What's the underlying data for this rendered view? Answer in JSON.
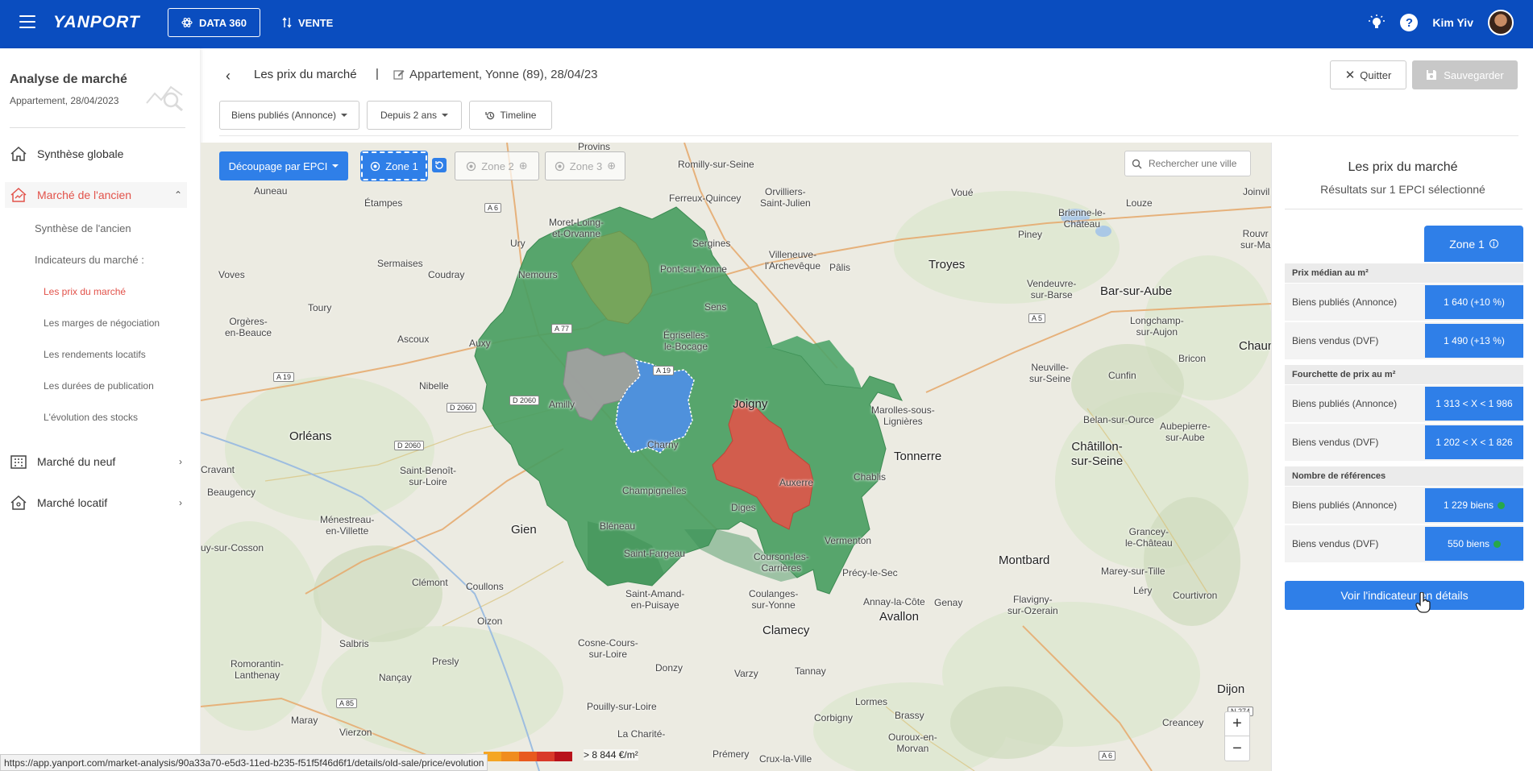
{
  "topbar": {
    "logo": "YANPORT",
    "data360_label": "DATA 360",
    "vente_label": "VENTE",
    "user_name": "Kim Yiv"
  },
  "sidebar": {
    "title": "Analyse de marché",
    "subtitle": "Appartement, 28/04/2023",
    "items": [
      {
        "label": "Synthèse globale"
      },
      {
        "label": "Marché de l'ancien"
      },
      {
        "label": "Marché du neuf"
      },
      {
        "label": "Marché locatif"
      }
    ],
    "sub_items": [
      {
        "label": "Synthèse de l'ancien"
      },
      {
        "label": "Indicateurs du marché :"
      }
    ],
    "indicators": [
      {
        "label": "Les prix du marché"
      },
      {
        "label": "Les marges de négociation"
      },
      {
        "label": "Les rendements locatifs"
      },
      {
        "label": "Les durées de publication"
      },
      {
        "label": "L'évolution des stocks"
      }
    ]
  },
  "header": {
    "title": "Les prix du marché",
    "separator": "|",
    "subtitle": "Appartement, Yonne (89), 28/04/23",
    "quit_label": "Quitter",
    "save_label": "Sauvegarder"
  },
  "filters": {
    "source": "Biens publiés (Annonce)",
    "period": "Depuis 2 ans",
    "timeline": "Timeline"
  },
  "map": {
    "decoupage_label": "Découpage par EPCI",
    "zones": [
      "Zone 1",
      "Zone 2",
      "Zone 3"
    ],
    "search_placeholder": "Rechercher une ville",
    "zoom_in": "+",
    "zoom_out": "−",
    "legend_text": "> 8 844 €/m²",
    "legend_colors": [
      "#f5a623",
      "#f08c1e",
      "#e85a1f",
      "#d93a2a",
      "#b8121b"
    ],
    "region_colors": {
      "green": "#4a9e62",
      "light_green": "#7aa55a",
      "grey": "#a0a0a0",
      "blue": "#4f8fe3",
      "red": "#d9594c"
    },
    "places": [
      {
        "name": "Provins"
      },
      {
        "name": "Romilly-sur-Seine"
      },
      {
        "name": "Auneau"
      },
      {
        "name": "Étampes"
      },
      {
        "name": "Moret-Loing-\net-Orvanne"
      },
      {
        "name": "Ferreux-Quincey"
      },
      {
        "name": "Orvilliers-\nSaint-Julien"
      },
      {
        "name": "Voué"
      },
      {
        "name": "Piney"
      },
      {
        "name": "Brienne-le-\nChâteau"
      },
      {
        "name": "Louze"
      },
      {
        "name": "Joinvil"
      },
      {
        "name": "Sergines"
      },
      {
        "name": "Pont-sur-Yonne"
      },
      {
        "name": "Villeneuve-\nl'Archevêque"
      },
      {
        "name": "Pâlis"
      },
      {
        "name": "Troyes"
      },
      {
        "name": "Ury"
      },
      {
        "name": "Sermaises"
      },
      {
        "name": "Coudray"
      },
      {
        "name": "Nemours"
      },
      {
        "name": "Voves"
      },
      {
        "name": "Sens"
      },
      {
        "name": "Vendeuvre-\nsur-Barse"
      },
      {
        "name": "Bar-sur-Aube"
      },
      {
        "name": "Rouvr\nsur-Ma"
      },
      {
        "name": "Toury"
      },
      {
        "name": "Orgères-\nen-Beauce"
      },
      {
        "name": "Ascoux"
      },
      {
        "name": "Auxy"
      },
      {
        "name": "Égriselles-\nle-Bocage"
      },
      {
        "name": "Longchamp-\nsur-Aujon"
      },
      {
        "name": "Chaum"
      },
      {
        "name": "Neuville-\nsur-Seine"
      },
      {
        "name": "Cunfin"
      },
      {
        "name": "Bricon"
      },
      {
        "name": "Nibelle"
      },
      {
        "name": "Amilly"
      },
      {
        "name": "Joigny"
      },
      {
        "name": "Marolles-sous-\nLignières"
      },
      {
        "name": "Orléans"
      },
      {
        "name": "Charny"
      },
      {
        "name": "Belan-sur-Ource"
      },
      {
        "name": "Aubepierre-\nsur-Aube"
      },
      {
        "name": "Tonnerre"
      },
      {
        "name": "Châtillon-\nsur-Seine"
      },
      {
        "name": "Cravant"
      },
      {
        "name": "Saint-Benoît-\nsur-Loire"
      },
      {
        "name": "Auxerre"
      },
      {
        "name": "Chablis"
      },
      {
        "name": "Beaugency"
      },
      {
        "name": "Champignelles"
      },
      {
        "name": "Diges"
      },
      {
        "name": "Ménestreau-\nen-Villette"
      },
      {
        "name": "Bléneau"
      },
      {
        "name": "Gien"
      },
      {
        "name": "Vermenton"
      },
      {
        "name": "Grancey-\nle-Château"
      },
      {
        "name": "uy-sur-Cosson"
      },
      {
        "name": "Saint-Fargeau"
      },
      {
        "name": "Courson-les-\nCarrières"
      },
      {
        "name": "Montbard"
      },
      {
        "name": "Coullons"
      },
      {
        "name": "Précy-le-Sec"
      },
      {
        "name": "Marey-sur-Tille"
      },
      {
        "name": "Clémont"
      },
      {
        "name": "Saint-Amand-\nen-Puisaye"
      },
      {
        "name": "Coulanges-\nsur-Yonne"
      },
      {
        "name": "Annay-la-Côte"
      },
      {
        "name": "Genay"
      },
      {
        "name": "Léry"
      },
      {
        "name": "Courtivron"
      },
      {
        "name": "Avallon"
      },
      {
        "name": "Flavigny-\nsur-Ozerain"
      },
      {
        "name": "Oizon"
      },
      {
        "name": "Clamecy"
      },
      {
        "name": "Salbris"
      },
      {
        "name": "Presly"
      },
      {
        "name": "Cosne-Cours-\nsur-Loire"
      },
      {
        "name": "Romorantin-\nLanthenay"
      },
      {
        "name": "Nançay"
      },
      {
        "name": "Donzy"
      },
      {
        "name": "Varzy"
      },
      {
        "name": "Tannay"
      },
      {
        "name": "Maray"
      },
      {
        "name": "Pouilly-sur-Loire"
      },
      {
        "name": "Lormes"
      },
      {
        "name": "Dijon"
      },
      {
        "name": "Vierzon"
      },
      {
        "name": "Corbigny"
      },
      {
        "name": "Brassy"
      },
      {
        "name": "Creancey"
      },
      {
        "name": "La Charité-"
      },
      {
        "name": "Prémery"
      },
      {
        "name": "Crux-la-Ville"
      },
      {
        "name": "Ouroux-en-\nMorvan"
      }
    ],
    "roads": [
      "A 6",
      "A 77",
      "A 19",
      "A 19",
      "D 2060",
      "D 2060",
      "D 2060",
      "A 5",
      "A 85",
      "A 6",
      "N 274"
    ]
  },
  "panel": {
    "title": "Les prix du marché",
    "subtitle": "Résultats sur 1 EPCI sélectionné",
    "zone_tab": "Zone 1",
    "sections": [
      {
        "heading": "Prix médian au m²",
        "rows": [
          {
            "label": "Biens publiés (Annonce)",
            "value": "1 640 (+10 %)"
          },
          {
            "label": "Biens vendus (DVF)",
            "value": "1 490 (+13 %)"
          }
        ]
      },
      {
        "heading": "Fourchette de prix au m²",
        "rows": [
          {
            "label": "Biens publiés (Annonce)",
            "value": "1 313 < X < 1 986"
          },
          {
            "label": "Biens vendus (DVF)",
            "value": "1 202 < X < 1 826"
          }
        ]
      },
      {
        "heading": "Nombre de références",
        "rows": [
          {
            "label": "Biens publiés (Annonce)",
            "value": "1 229 biens"
          },
          {
            "label": "Biens vendus (DVF)",
            "value": "550 biens"
          }
        ]
      }
    ],
    "details_button": "Voir l'indicateur en détails"
  },
  "status_url": "https://app.yanport.com/market-analysis/90a33a70-e5d3-11ed-b235-f51f5f46d6f1/details/old-sale/price/evolution"
}
